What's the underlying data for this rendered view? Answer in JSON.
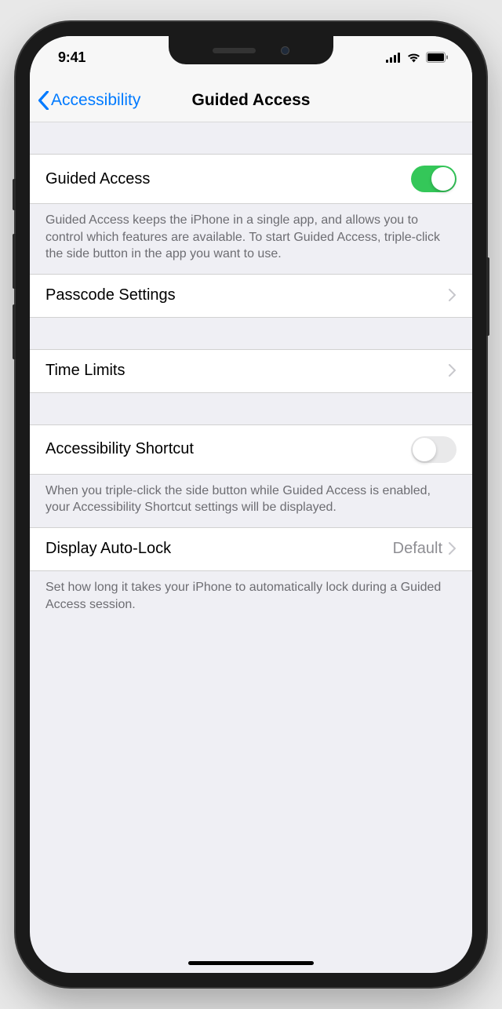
{
  "statusBar": {
    "time": "9:41"
  },
  "nav": {
    "backLabel": "Accessibility",
    "title": "Guided Access"
  },
  "rows": {
    "guidedAccess": {
      "label": "Guided Access",
      "on": true,
      "footer": "Guided Access keeps the iPhone in a single app, and allows you to control which features are available. To start Guided Access, triple-click the side button in the app you want to use."
    },
    "passcode": {
      "label": "Passcode Settings"
    },
    "timeLimits": {
      "label": "Time Limits"
    },
    "accessibilityShortcut": {
      "label": "Accessibility Shortcut",
      "on": false,
      "footer": "When you triple-click the side button while Guided Access is enabled, your Accessibility Shortcut settings will be displayed."
    },
    "autoLock": {
      "label": "Display Auto-Lock",
      "value": "Default",
      "footer": "Set how long it takes your iPhone to automatically lock during a Guided Access session."
    }
  }
}
